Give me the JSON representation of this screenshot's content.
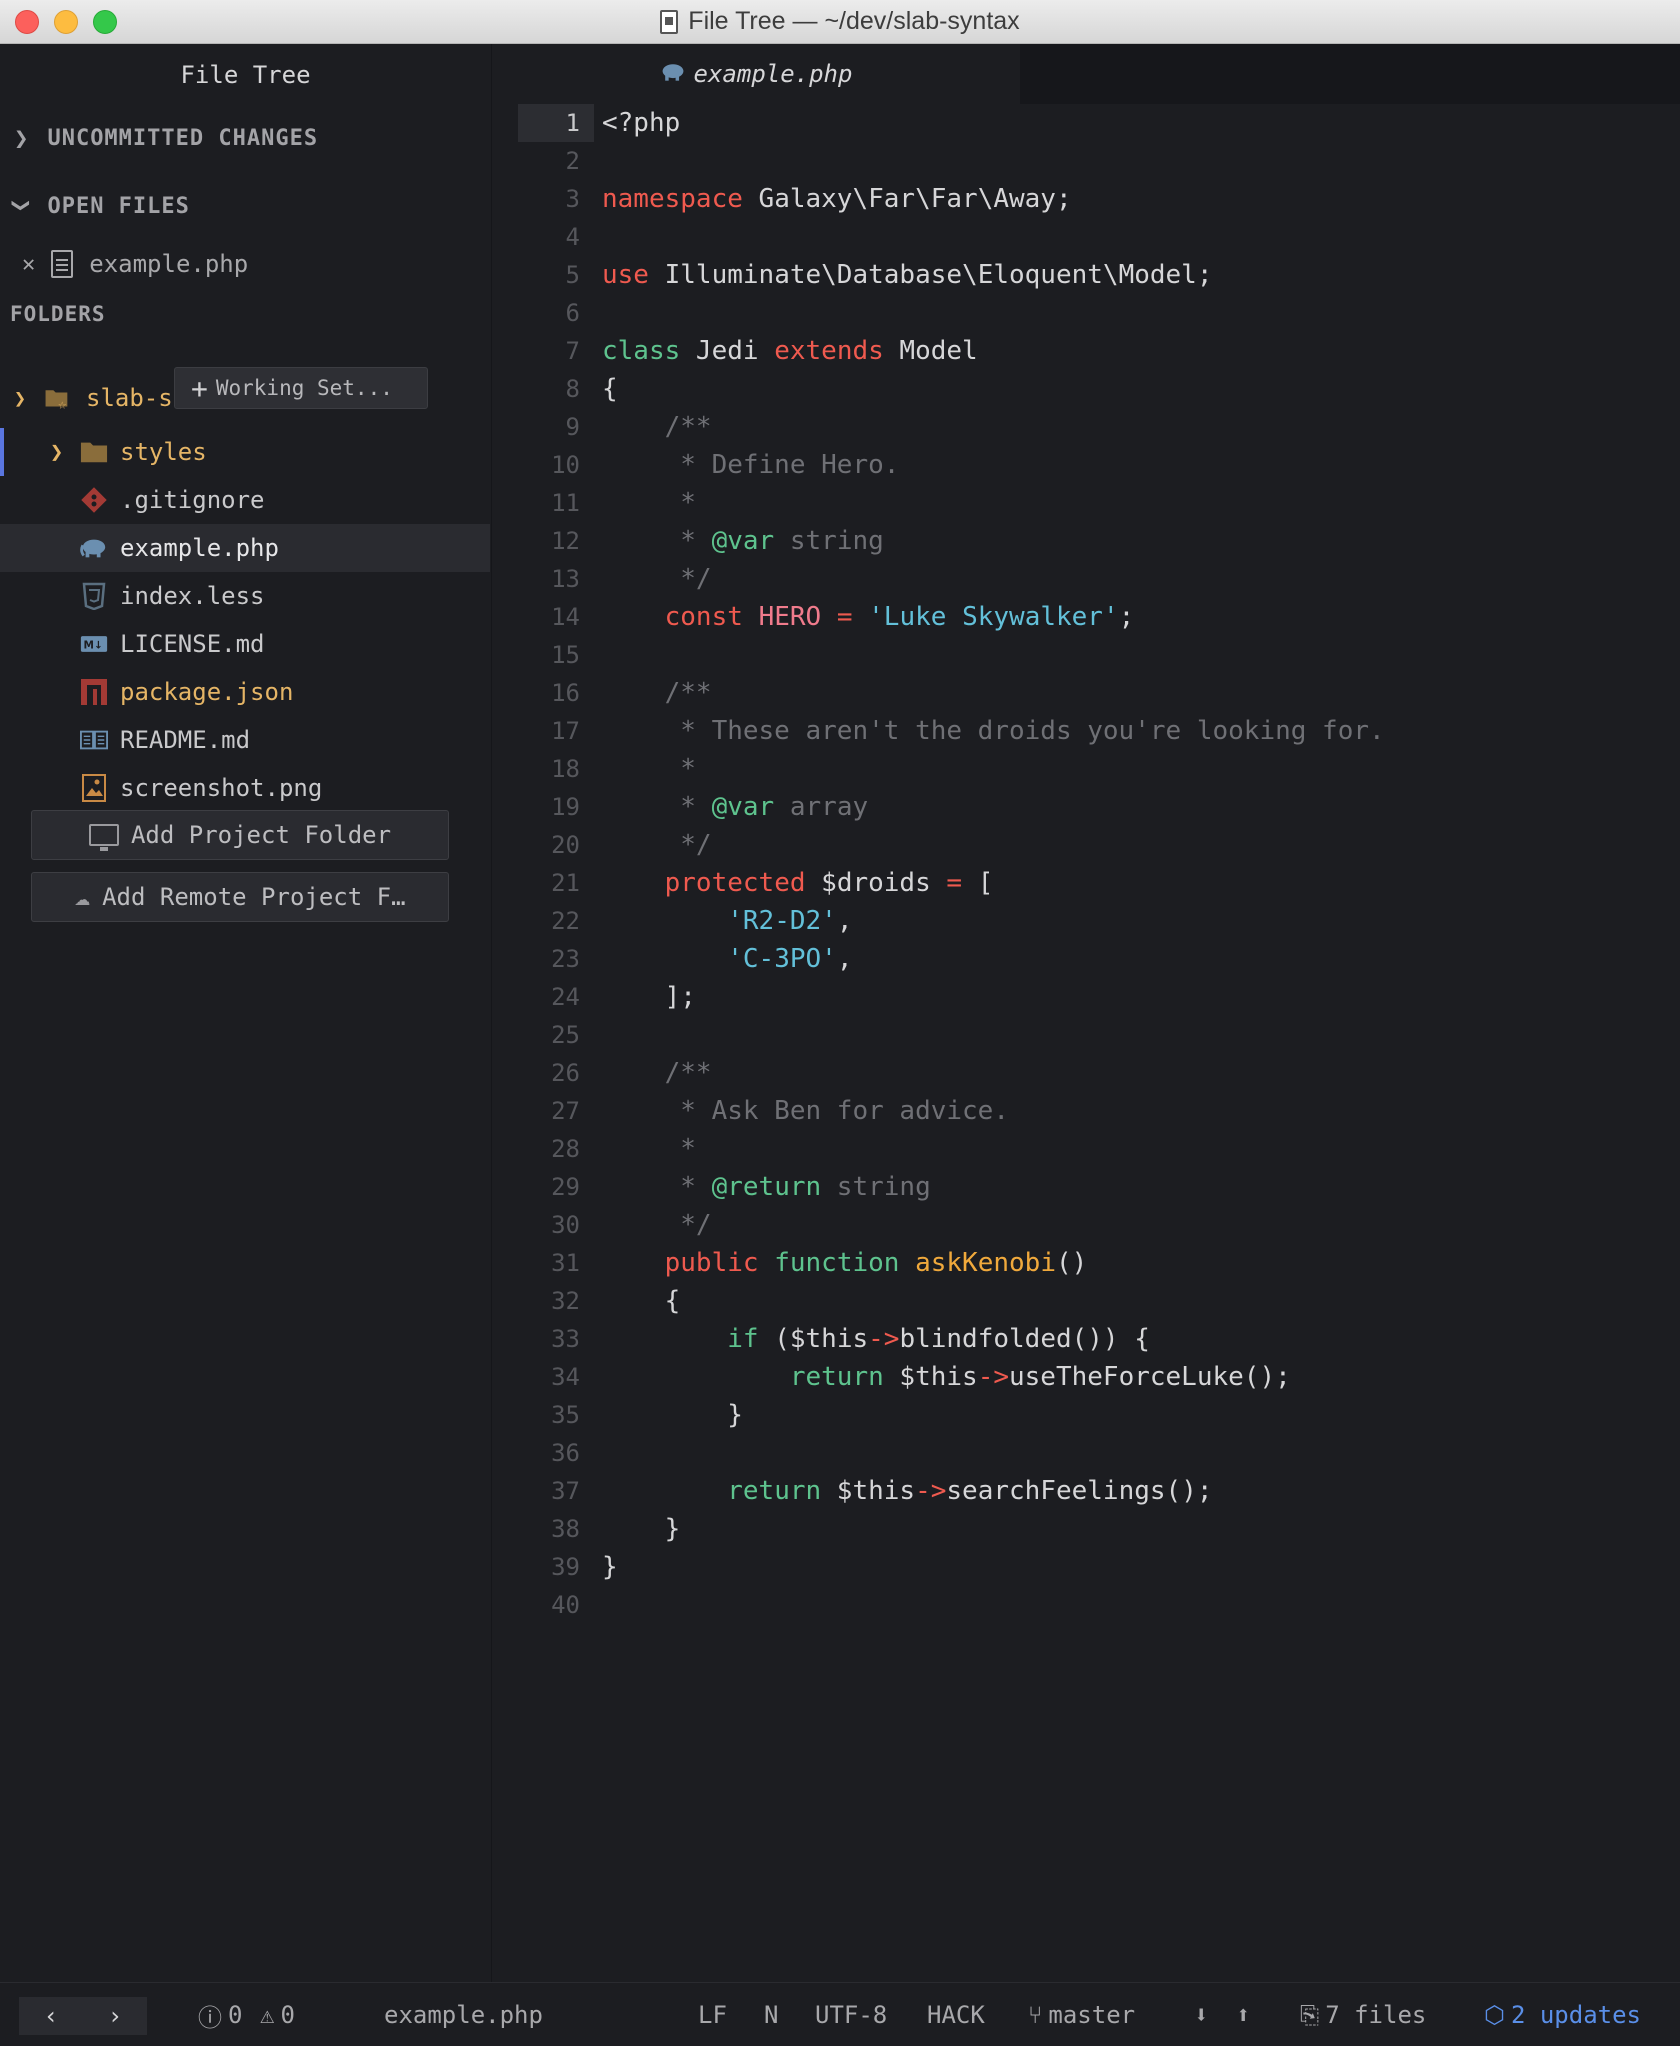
{
  "window": {
    "title": "File Tree — ~/dev/slab-syntax"
  },
  "sidebar": {
    "header": "File Tree",
    "uncommitted": "UNCOMMITTED CHANGES",
    "open_files": "OPEN FILES",
    "open_file_name": "example.php",
    "folders": "FOLDERS",
    "root": "slab-s",
    "working_set": "Working Set...",
    "items": [
      {
        "label": "styles",
        "icon": "folder-icon"
      },
      {
        "label": ".gitignore",
        "icon": "git-icon"
      },
      {
        "label": "example.php",
        "icon": "php-elephant-icon"
      },
      {
        "label": "index.less",
        "icon": "css-icon"
      },
      {
        "label": "LICENSE.md",
        "icon": "markdown-icon"
      },
      {
        "label": "package.json",
        "icon": "npm-icon"
      },
      {
        "label": "README.md",
        "icon": "book-icon"
      },
      {
        "label": "screenshot.png",
        "icon": "image-icon"
      }
    ],
    "add_project": "Add Project Folder",
    "add_remote": "Add Remote Project F…"
  },
  "tab": {
    "label": "example.php"
  },
  "editor": {
    "current_line": 1,
    "lines": [
      [
        [
          "<?php",
          "p"
        ]
      ],
      [],
      [
        [
          "namespace",
          "kw"
        ],
        [
          " Galaxy\\Far\\Far\\Away;",
          "p"
        ]
      ],
      [],
      [
        [
          "use",
          "kw"
        ],
        [
          " Illuminate\\Database\\Eloquent\\Model;",
          "p"
        ]
      ],
      [],
      [
        [
          "class",
          "kg"
        ],
        [
          " Jedi ",
          "p"
        ],
        [
          "extends",
          "kw"
        ],
        [
          " Model",
          "p"
        ]
      ],
      [
        [
          "{",
          "p"
        ]
      ],
      [
        [
          "    /**",
          "cm"
        ]
      ],
      [
        [
          "     * Define Hero.",
          "cm"
        ]
      ],
      [
        [
          "     *",
          "cm"
        ]
      ],
      [
        [
          "     * ",
          "cm"
        ],
        [
          "@var",
          "tg"
        ],
        [
          " string",
          "cm"
        ]
      ],
      [
        [
          "     */",
          "cm"
        ]
      ],
      [
        [
          "    ",
          "p"
        ],
        [
          "const",
          "kw"
        ],
        [
          " ",
          "p"
        ],
        [
          "HERO",
          "cn"
        ],
        [
          " ",
          "p"
        ],
        [
          "=",
          "op"
        ],
        [
          " ",
          "p"
        ],
        [
          "'Luke Skywalker'",
          "st"
        ],
        [
          ";",
          "p"
        ]
      ],
      [],
      [
        [
          "    /**",
          "cm"
        ]
      ],
      [
        [
          "     * These aren't the droids you're looking for.",
          "cm"
        ]
      ],
      [
        [
          "     *",
          "cm"
        ]
      ],
      [
        [
          "     * ",
          "cm"
        ],
        [
          "@var",
          "tg"
        ],
        [
          " array",
          "cm"
        ]
      ],
      [
        [
          "     */",
          "cm"
        ]
      ],
      [
        [
          "    ",
          "p"
        ],
        [
          "protected",
          "kw"
        ],
        [
          " $droids ",
          "p"
        ],
        [
          "=",
          "op"
        ],
        [
          " [",
          "p"
        ]
      ],
      [
        [
          "        ",
          "p"
        ],
        [
          "'R2-D2'",
          "st"
        ],
        [
          ",",
          "p"
        ]
      ],
      [
        [
          "        ",
          "p"
        ],
        [
          "'C-3PO'",
          "st"
        ],
        [
          ",",
          "p"
        ]
      ],
      [
        [
          "    ];",
          "p"
        ]
      ],
      [],
      [
        [
          "    /**",
          "cm"
        ]
      ],
      [
        [
          "     * Ask Ben for advice.",
          "cm"
        ]
      ],
      [
        [
          "     *",
          "cm"
        ]
      ],
      [
        [
          "     * ",
          "cm"
        ],
        [
          "@return",
          "tg"
        ],
        [
          " string",
          "cm"
        ]
      ],
      [
        [
          "     */",
          "cm"
        ]
      ],
      [
        [
          "    ",
          "p"
        ],
        [
          "public",
          "kw"
        ],
        [
          " ",
          "p"
        ],
        [
          "function",
          "kg"
        ],
        [
          " ",
          "p"
        ],
        [
          "askKenobi",
          "fn"
        ],
        [
          "()",
          "p"
        ]
      ],
      [
        [
          "    {",
          "p"
        ]
      ],
      [
        [
          "        ",
          "p"
        ],
        [
          "if",
          "kg"
        ],
        [
          " ($this",
          "p"
        ],
        [
          "->",
          "op"
        ],
        [
          "blindfolded()) {",
          "p"
        ]
      ],
      [
        [
          "            ",
          "p"
        ],
        [
          "return",
          "kg"
        ],
        [
          " $this",
          "p"
        ],
        [
          "->",
          "op"
        ],
        [
          "useTheForceLuke();",
          "p"
        ]
      ],
      [
        [
          "        }",
          "p"
        ]
      ],
      [],
      [
        [
          "        ",
          "p"
        ],
        [
          "return",
          "kg"
        ],
        [
          " $this",
          "p"
        ],
        [
          "->",
          "op"
        ],
        [
          "searchFeelings();",
          "p"
        ]
      ],
      [
        [
          "    }",
          "p"
        ]
      ],
      [
        [
          "}",
          "p"
        ]
      ],
      []
    ]
  },
  "status": {
    "errors": "0",
    "warnings": "0",
    "file": "example.php",
    "eol": "LF",
    "mode": "N",
    "encoding": "UTF-8",
    "grammar": "HACK",
    "branch": "master",
    "files": "7 files",
    "updates": "2 updates"
  }
}
